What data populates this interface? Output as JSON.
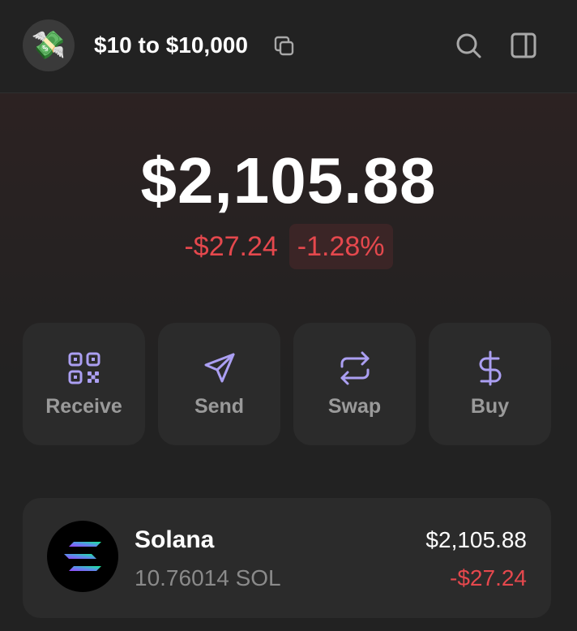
{
  "header": {
    "avatar_emoji": "💸",
    "account_name": "$10 to $10,000",
    "icons": [
      "copy-icon",
      "search-icon",
      "sidebar-icon"
    ]
  },
  "portfolio": {
    "balance": "$2,105.88",
    "change_amount": "-$27.24",
    "change_percent": "-1.28%"
  },
  "actions": [
    {
      "label": "Receive",
      "icon": "qr-code-icon"
    },
    {
      "label": "Send",
      "icon": "send-icon"
    },
    {
      "label": "Swap",
      "icon": "swap-icon"
    },
    {
      "label": "Buy",
      "icon": "dollar-icon"
    }
  ],
  "tokens": [
    {
      "name": "Solana",
      "amount": "10.76014 SOL",
      "value": "$2,105.88",
      "change": "-$27.24",
      "icon": "solana-logo"
    }
  ],
  "colors": {
    "background": "#222222",
    "card": "#2b2b2b",
    "accent": "#ab9ff2",
    "negative": "#e5484d",
    "muted_text": "#9a9a9a"
  }
}
